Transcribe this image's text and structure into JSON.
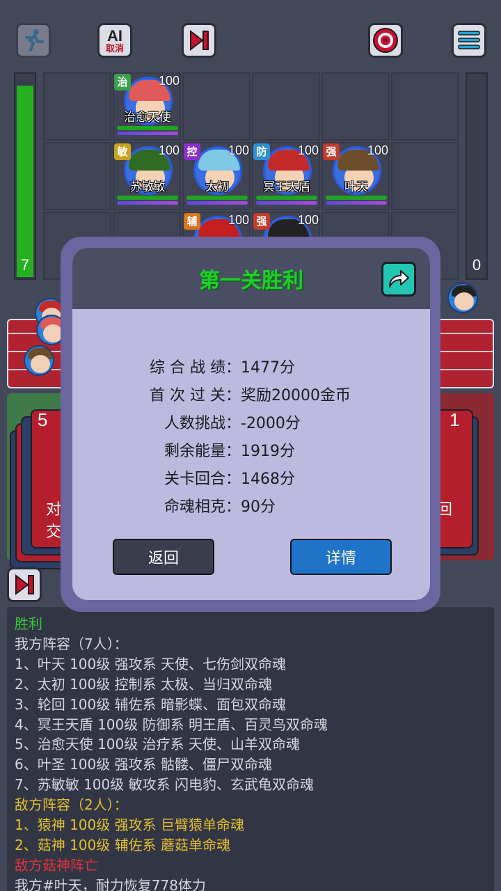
{
  "toolbar": {
    "ai_label": "AI",
    "ai_cancel_label": "取消"
  },
  "energy": {
    "left_value": "7",
    "right_value": "0",
    "left_fill_fraction": 0.95,
    "right_fill_fraction": 0
  },
  "board": {
    "heroes": [
      {
        "name": "治愈天使",
        "role": "治",
        "level": "100",
        "role_color": "#3aa14a",
        "hair": "#e05a5a"
      },
      {
        "name": "苏敏敏",
        "role": "敏",
        "level": "100",
        "role_color": "#c9a21e",
        "hair": "#2f6b23"
      },
      {
        "name": "太初",
        "role": "控",
        "level": "100",
        "role_color": "#8a2fc9",
        "hair": "#7fc9e6"
      },
      {
        "name": "冥王天盾",
        "role": "防",
        "level": "100",
        "role_color": "#2f8fcf",
        "hair": "#c42a2a"
      },
      {
        "name": "叶天",
        "role": "强",
        "level": "100",
        "role_color": "#c23b2b",
        "hair": "#6b4d2a"
      },
      {
        "name": "",
        "role": "辅",
        "level": "100",
        "role_color": "#d9741e",
        "hair": "#c41e1e"
      },
      {
        "name": "",
        "role": "强",
        "level": "100",
        "role_color": "#c23b2b",
        "hair": "#222222"
      }
    ]
  },
  "cards": {
    "left_count": "5",
    "right_count": "1",
    "left_text_1": "对",
    "left_text_2": "交",
    "right_text": "回"
  },
  "modal": {
    "title": "第一关胜利",
    "stats": [
      {
        "key": "综 合 战 绩：",
        "value": "1477分"
      },
      {
        "key": "首 次 过 关：",
        "value": "奖励20000金币"
      },
      {
        "key": "人数挑战：",
        "value": "-2000分"
      },
      {
        "key": "剩余能量：",
        "value": "1919分"
      },
      {
        "key": "关卡回合：",
        "value": "1468分"
      },
      {
        "key": "命魂相克：",
        "value": "90分"
      }
    ],
    "back_label": "返回",
    "detail_label": "详情"
  },
  "log": {
    "lines": [
      {
        "text": "胜利",
        "color": "green"
      },
      {
        "text": "我方阵容（7人）：",
        "color": "gray"
      },
      {
        "text": "1、叶天 100级 强攻系 天使、七伤剑双命魂",
        "color": "gray"
      },
      {
        "text": "2、太初 100级 控制系 太极、当归双命魂",
        "color": "gray"
      },
      {
        "text": "3、轮回 100级 辅佐系 暗影蝶、面包双命魂",
        "color": "gray"
      },
      {
        "text": "4、冥王天盾 100级 防御系 明王盾、百灵鸟双命魂",
        "color": "gray"
      },
      {
        "text": "5、治愈天使 100级 治疗系 天使、山羊双命魂",
        "color": "gray"
      },
      {
        "text": "6、叶圣 100级 强攻系 骷髅、僵尸双命魂",
        "color": "gray"
      },
      {
        "text": "7、苏敏敏 100级 敏攻系 闪电豹、玄武龟双命魂",
        "color": "gray"
      },
      {
        "text": "敌方阵容（2人）：",
        "color": "yellow"
      },
      {
        "text": "1、猿神 100级 强攻系 巨臂猿单命魂",
        "color": "yellow"
      },
      {
        "text": "2、菇神 100级 辅佐系 蘑菇单命魂",
        "color": "yellow"
      },
      {
        "text": "敌方菇神阵亡",
        "color": "red"
      },
      {
        "text": "我方#叶天，耐力恢复778体力",
        "color": "gray"
      }
    ]
  }
}
